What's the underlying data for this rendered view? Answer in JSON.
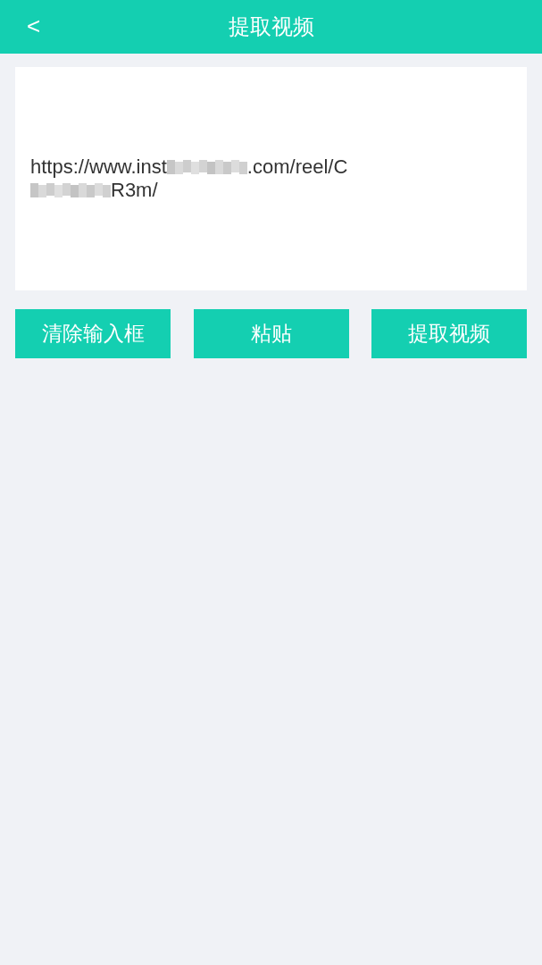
{
  "header": {
    "back_icon": "<",
    "title": "提取视频"
  },
  "input": {
    "lines": [
      [
        {
          "kind": "text",
          "text": "https://www.inst"
        },
        {
          "kind": "redacted"
        },
        {
          "kind": "text",
          "text": ".com/reel/C"
        }
      ],
      [
        {
          "kind": "redacted"
        },
        {
          "kind": "text",
          "text": "R3m/"
        }
      ]
    ]
  },
  "buttons": [
    "清除输入框",
    "粘贴",
    "提取视频"
  ]
}
